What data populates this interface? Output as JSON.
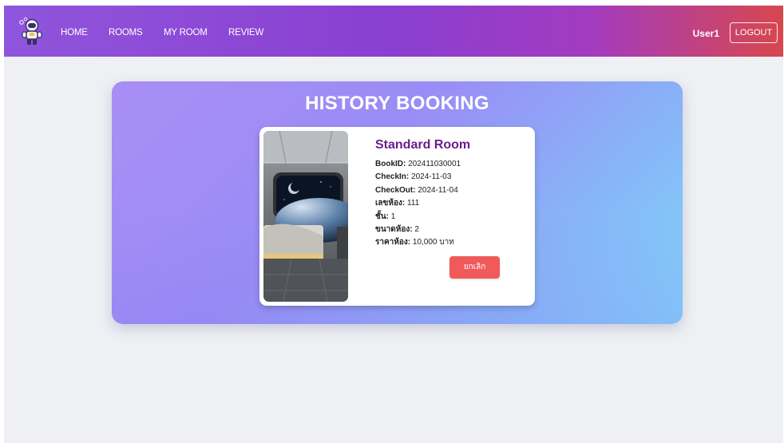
{
  "nav": {
    "logo": "astronaut-logo",
    "links": [
      "HOME",
      "ROOMS",
      "MY ROOM",
      "REVIEW"
    ],
    "user": "User1",
    "logout": "LOGOUT"
  },
  "panel": {
    "title": "HISTORY BOOKING"
  },
  "booking": {
    "room_type": "Standard Room",
    "bookid_label": "BookID:",
    "bookid_value": " 202411030001",
    "checkin_label": "CheckIn:",
    "checkin_value": " 2024-11-03",
    "checkout_label": "CheckOut:",
    "checkout_value": " 2024-11-04",
    "room_no_label": "เลขห้อง:",
    "room_no_value": " 111",
    "floor_label": "ชั้น:",
    "floor_value": " 1",
    "size_label": "ขนาดห้อง:",
    "size_value": " 2",
    "price_label": "ราคาห้อง:",
    "price_value": " 10,000 บาท",
    "cancel_label": "ยกเลิก",
    "image": "space-bedroom-photo"
  },
  "colors": {
    "title_purple": "#6d1b8e",
    "cancel_red": "#f05a5a"
  }
}
